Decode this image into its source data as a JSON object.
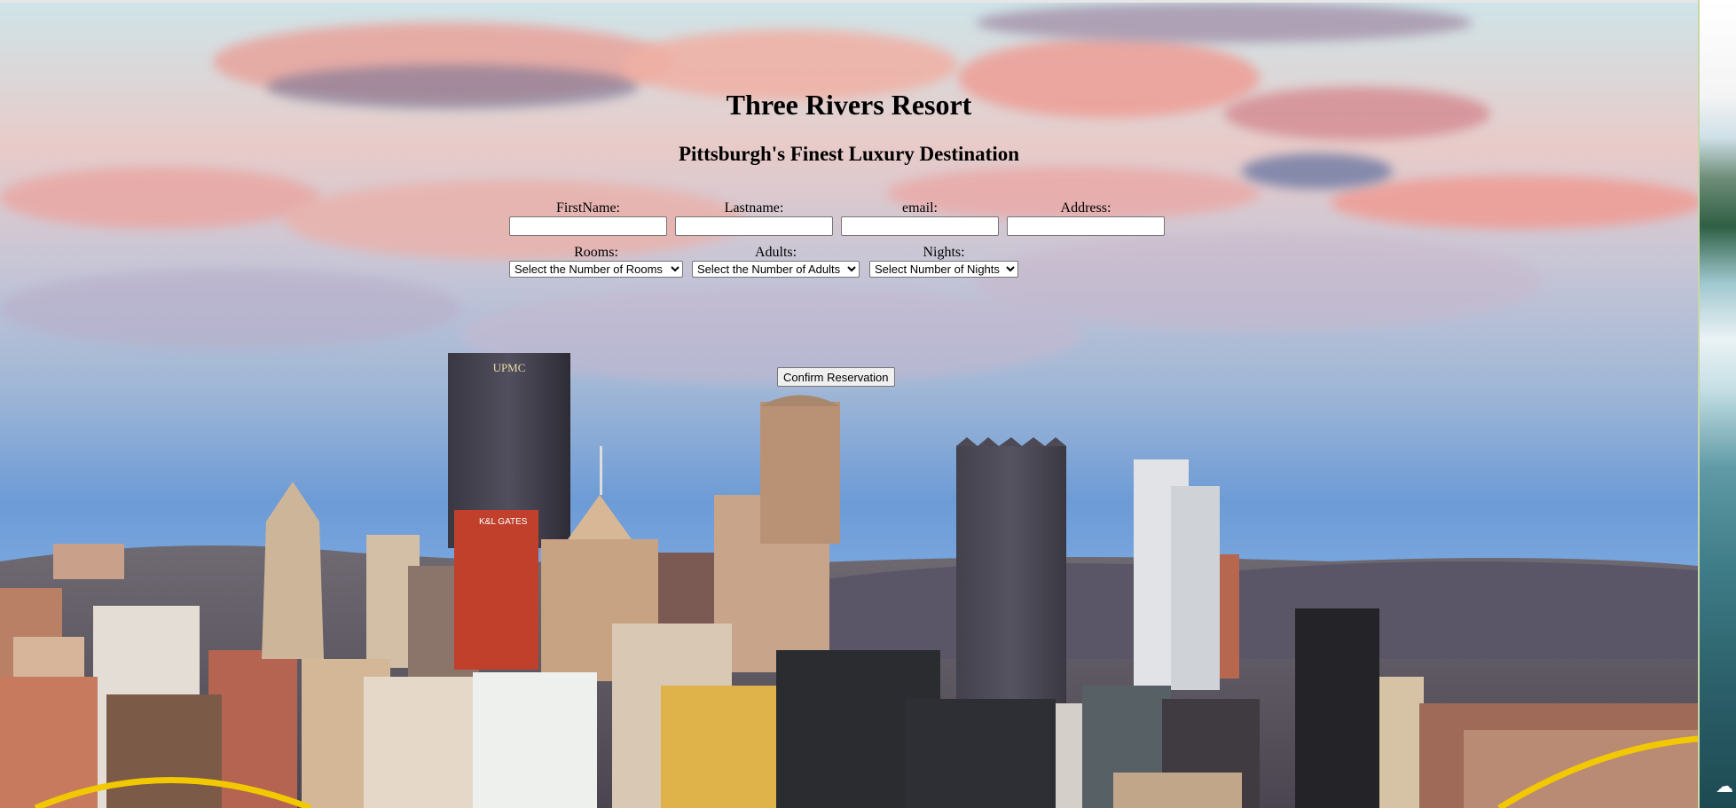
{
  "header": {
    "title": "Three Rivers Resort",
    "subtitle": "Pittsburgh's Finest Luxury Destination"
  },
  "form": {
    "firstname_label": "FirstName:",
    "lastname_label": "Lastname:",
    "email_label": "email:",
    "address_label": "Address:",
    "firstname_value": "",
    "lastname_value": "",
    "email_value": "",
    "address_value": "",
    "rooms_label": "Rooms:",
    "adults_label": "Adults:",
    "nights_label": "Nights:",
    "rooms_selected": "Select the Number of Rooms",
    "adults_selected": "Select the Number of Adults",
    "nights_selected": "Select Number of Nights",
    "confirm_label": "Confirm Reservation"
  },
  "background": {
    "building_signs": [
      "UPMC",
      "K&L GATES"
    ]
  },
  "colors": {
    "sky_top": "#cfe4e8",
    "sky_bottom": "#7ba8e0",
    "cloud_pink": "#e8a29a",
    "bridge_yellow": "#f2c800"
  }
}
